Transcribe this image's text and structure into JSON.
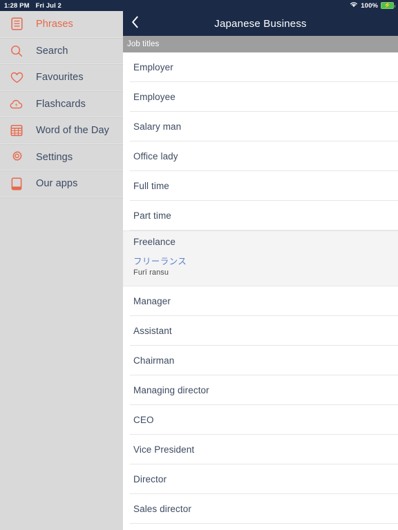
{
  "status_bar": {
    "time": "1:28 PM",
    "date": "Fri Jul 2",
    "battery_percent": "100%",
    "wifi_icon": "wifi-icon",
    "battery_icon": "battery-charging-icon"
  },
  "sidebar": {
    "items": [
      {
        "label": "Phrases",
        "icon": "list-document-icon",
        "active": true
      },
      {
        "label": "Search",
        "icon": "search-icon",
        "active": false
      },
      {
        "label": "Favourites",
        "icon": "heart-icon",
        "active": false
      },
      {
        "label": "Flashcards",
        "icon": "cloud-bolt-icon",
        "active": false
      },
      {
        "label": "Word of the Day",
        "icon": "calendar-icon",
        "active": false
      },
      {
        "label": "Settings",
        "icon": "gear-icon",
        "active": false
      },
      {
        "label": "Our apps",
        "icon": "tablet-book-icon",
        "active": false
      }
    ]
  },
  "navbar": {
    "title": "Japanese Business",
    "back_icon": "chevron-left-icon"
  },
  "section_header": {
    "label": "Job titles"
  },
  "list": {
    "rows": [
      {
        "title": "Employer",
        "expanded": false
      },
      {
        "title": "Employee",
        "expanded": false
      },
      {
        "title": "Salary man",
        "expanded": false
      },
      {
        "title": "Office lady",
        "expanded": false
      },
      {
        "title": "Full time",
        "expanded": false
      },
      {
        "title": "Part time",
        "expanded": false
      },
      {
        "title": "Freelance",
        "expanded": true,
        "japanese": "フリーランス",
        "romaji": "Furī ransu"
      },
      {
        "title": "Manager",
        "expanded": false
      },
      {
        "title": "Assistant",
        "expanded": false
      },
      {
        "title": "Chairman",
        "expanded": false
      },
      {
        "title": "Managing director",
        "expanded": false
      },
      {
        "title": "CEO",
        "expanded": false
      },
      {
        "title": "Vice President",
        "expanded": false
      },
      {
        "title": "Director",
        "expanded": false
      },
      {
        "title": "Sales director",
        "expanded": false
      }
    ]
  },
  "colors": {
    "navy": "#1b2b47",
    "accent_orange": "#e8674a",
    "sidebar_gray": "#d9d9d9",
    "section_gray": "#9e9e9e",
    "japanese_blue": "#5c81c8",
    "text_slate": "#3d4a60",
    "expanded_row_bg": "#f4f4f5",
    "battery_green": "#4cc14c"
  }
}
